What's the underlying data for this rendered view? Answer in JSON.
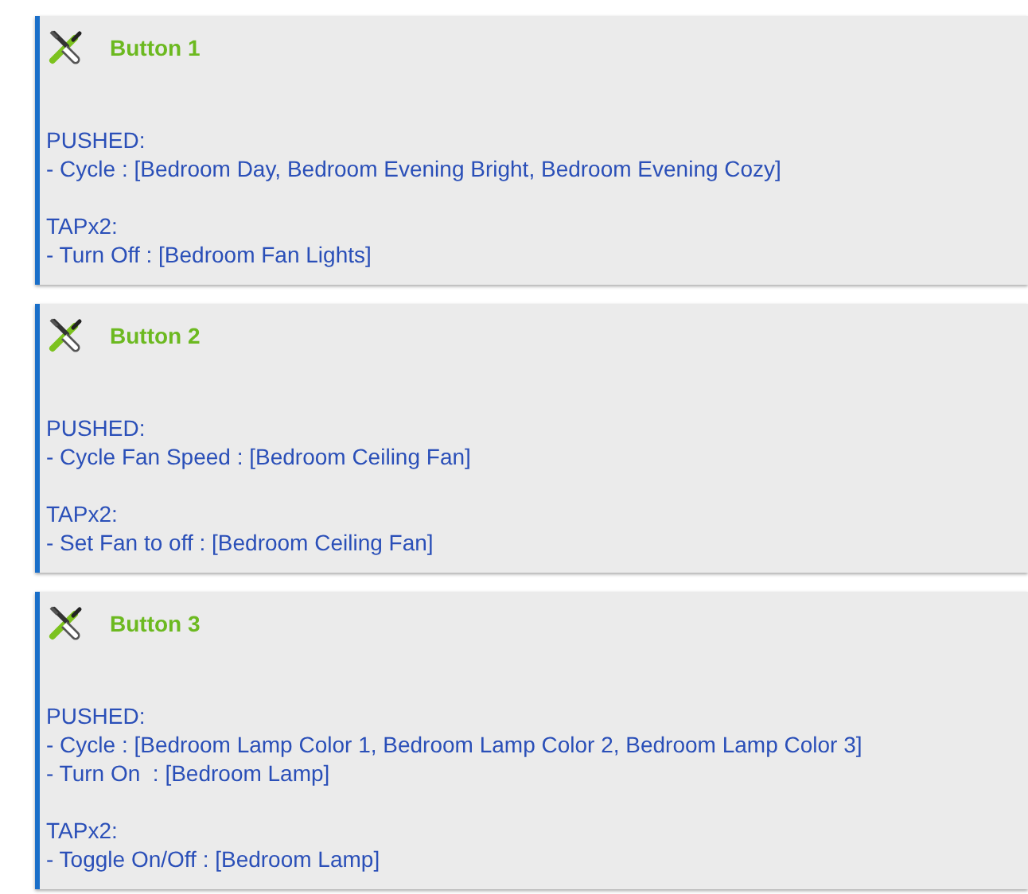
{
  "cards": [
    {
      "title": "Button 1",
      "sections": [
        {
          "heading": "PUSHED:",
          "lines": [
            "- Cycle : [Bedroom Day, Bedroom Evening Bright, Bedroom Evening Cozy]"
          ]
        },
        {
          "heading": "TAPx2:",
          "lines": [
            "- Turn Off : [Bedroom Fan Lights]"
          ]
        }
      ]
    },
    {
      "title": "Button 2",
      "sections": [
        {
          "heading": "PUSHED:",
          "lines": [
            "- Cycle Fan Speed : [Bedroom Ceiling Fan]"
          ]
        },
        {
          "heading": "TAPx2:",
          "lines": [
            "- Set Fan to off : [Bedroom Ceiling Fan]"
          ]
        }
      ]
    },
    {
      "title": "Button 3",
      "sections": [
        {
          "heading": "PUSHED:",
          "lines": [
            "- Cycle : [Bedroom Lamp Color 1, Bedroom Lamp Color 2, Bedroom Lamp Color 3]",
            "- Turn On  : [Bedroom Lamp]"
          ]
        },
        {
          "heading": "TAPx2:",
          "lines": [
            "- Toggle On/Off : [Bedroom Lamp]"
          ]
        }
      ]
    }
  ]
}
